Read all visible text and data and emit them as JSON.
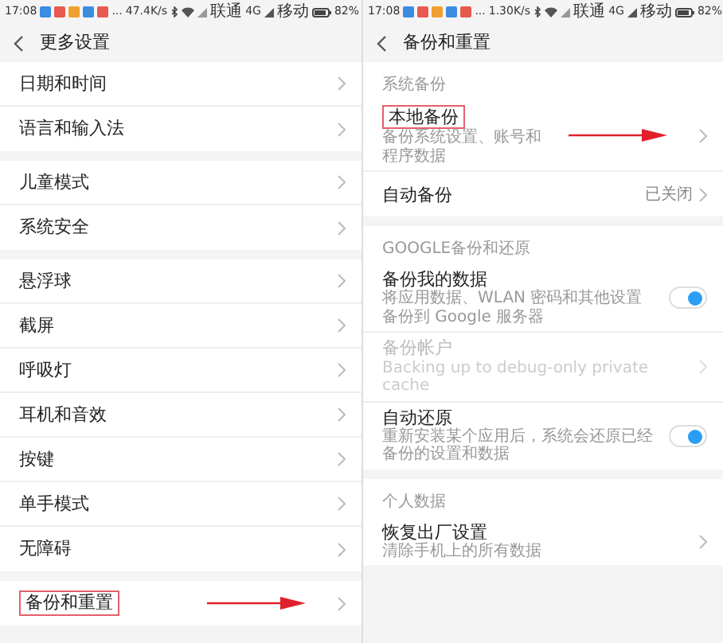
{
  "screens": [
    {
      "status_bar": {
        "time": "17:08",
        "more": "...",
        "speed": "47.4K/s",
        "carrier_1": "联通",
        "network": "4G",
        "carrier_2": "移动",
        "battery": "82%"
      },
      "title": "更多设置",
      "sections": [
        {
          "items": [
            {
              "title": "日期和时间",
              "kind": "link",
              "highlighted": false
            },
            {
              "title": "语言和输入法",
              "kind": "link",
              "highlighted": false
            }
          ]
        },
        {
          "items": [
            {
              "title": "儿童模式",
              "kind": "link",
              "highlighted": false
            },
            {
              "title": "系统安全",
              "kind": "link",
              "highlighted": false
            }
          ]
        },
        {
          "items": [
            {
              "title": "悬浮球",
              "kind": "link",
              "highlighted": false
            },
            {
              "title": "截屏",
              "kind": "link",
              "highlighted": false
            },
            {
              "title": "呼吸灯",
              "kind": "link",
              "highlighted": false
            },
            {
              "title": "耳机和音效",
              "kind": "link",
              "highlighted": false
            },
            {
              "title": "按键",
              "kind": "link",
              "highlighted": false
            },
            {
              "title": "单手模式",
              "kind": "link",
              "highlighted": false
            },
            {
              "title": "无障碍",
              "kind": "link",
              "highlighted": false
            }
          ]
        },
        {
          "items": [
            {
              "title": "备份和重置",
              "kind": "link",
              "highlighted": true
            }
          ]
        }
      ]
    },
    {
      "status_bar": {
        "time": "17:08",
        "more": "...",
        "speed": "1.30K/s",
        "carrier_1": "联通",
        "network": "4G",
        "carrier_2": "移动",
        "battery": "82%"
      },
      "title": "备份和重置",
      "sections": [
        {
          "header": "系统备份",
          "items": [
            {
              "title": "本地备份",
              "subtitle": "备份系统设置、账号和程序数据",
              "kind": "link",
              "highlighted": true,
              "disabled": false
            },
            {
              "title": "自动备份",
              "value": "已关闭",
              "kind": "link",
              "highlighted": false,
              "disabled": false
            }
          ]
        },
        {
          "header": "GOOGLE备份和还原",
          "items": [
            {
              "title": "备份我的数据",
              "subtitle": "将应用数据、WLAN 密码和其他设置备份到 Google 服务器",
              "kind": "toggle",
              "on": true,
              "highlighted": false,
              "disabled": false
            },
            {
              "title": "备份帐户",
              "subtitle": "Backing up to debug-only private cache",
              "kind": "link",
              "highlighted": false,
              "disabled": true
            },
            {
              "title": "自动还原",
              "subtitle": "重新安装某个应用后，系统会还原已经备份的设置和数据",
              "kind": "toggle",
              "on": true,
              "highlighted": false,
              "disabled": false
            }
          ]
        },
        {
          "header": "个人数据",
          "items": [
            {
              "title": "恢复出厂设置",
              "subtitle": "清除手机上的所有数据",
              "kind": "link",
              "highlighted": false,
              "disabled": false
            }
          ]
        }
      ]
    }
  ]
}
